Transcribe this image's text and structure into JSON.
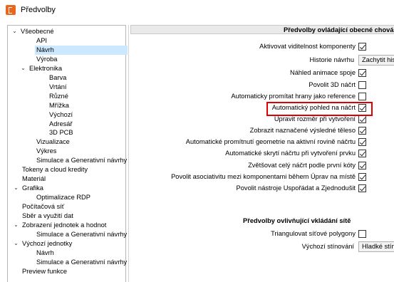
{
  "window": {
    "title": "Předvolby"
  },
  "tree": {
    "items": [
      {
        "label": "Všeobecné",
        "expander": "⌵"
      },
      {
        "label": "API"
      },
      {
        "label": "Návrh",
        "selected": true
      },
      {
        "label": "Výroba"
      },
      {
        "label": "Elektronika",
        "expander": "⌵"
      },
      {
        "label": "Barva"
      },
      {
        "label": "Vrtání"
      },
      {
        "label": "Různé"
      },
      {
        "label": "Mřížka"
      },
      {
        "label": "Výchozí"
      },
      {
        "label": "Adresář"
      },
      {
        "label": "3D PCB"
      },
      {
        "label": "Vizualizace"
      },
      {
        "label": "Výkres"
      },
      {
        "label": "Simulace a Generativní návrhy"
      },
      {
        "label": "Tokeny a cloud kredity"
      },
      {
        "label": "Materiál"
      },
      {
        "label": "Grafika",
        "expander": "⌵"
      },
      {
        "label": "Optimalizace RDP"
      },
      {
        "label": "Počítačová síť"
      },
      {
        "label": "Sběr a využití dat"
      },
      {
        "label": "Zobrazení jednotek a hodnot",
        "expander": "⌵"
      },
      {
        "label": "Simulace a Generativní návrhy"
      },
      {
        "label": "Výchozí jednotky",
        "expander": "⌵"
      },
      {
        "label": "Návrh"
      },
      {
        "label": "Simulace a Generativní návrhy"
      },
      {
        "label": "Preview funkce"
      }
    ]
  },
  "panel": {
    "header": "Předvolby ovládající obecné chová",
    "settings": [
      {
        "label": "Aktivovat viditelnost komponenty",
        "checked": true
      },
      {
        "label": "Historie návrhu",
        "combo": "Zachytit his"
      },
      {
        "label": "Náhled animace spoje",
        "checked": true
      },
      {
        "label": "Povolit 3D náčrt",
        "checked": false
      },
      {
        "label": "Automaticky promítat hrany jako reference",
        "checked": false
      },
      {
        "label": "Automatický pohled na náčrt",
        "checked": true
      },
      {
        "label": "Upravit rozměr při vytvoření",
        "checked": true
      },
      {
        "label": "Zobrazit naznačené výsledné těleso",
        "checked": true
      },
      {
        "label": "Automatické promítnutí geometrie na aktivní rovině náčrtu",
        "checked": true
      },
      {
        "label": "Automatické skrytí náčrtu při vytvoření prvku",
        "checked": true
      },
      {
        "label": "Zvětšovat celý náčrt podle první kóty",
        "checked": true
      },
      {
        "label": "Povolit asociativitu mezi komponentami během Úprav na místě",
        "checked": true
      },
      {
        "label": "Povolit nástroje Uspořádat a Zjednodušit",
        "checked": true
      }
    ],
    "subsection": {
      "header": "Předvolby ovlivňující vkládání sítě",
      "settings": [
        {
          "label": "Triangulovat síťové polygony",
          "checked": false
        },
        {
          "label": "Výchozí stínování",
          "combo": "Hladké stínc"
        }
      ]
    }
  }
}
